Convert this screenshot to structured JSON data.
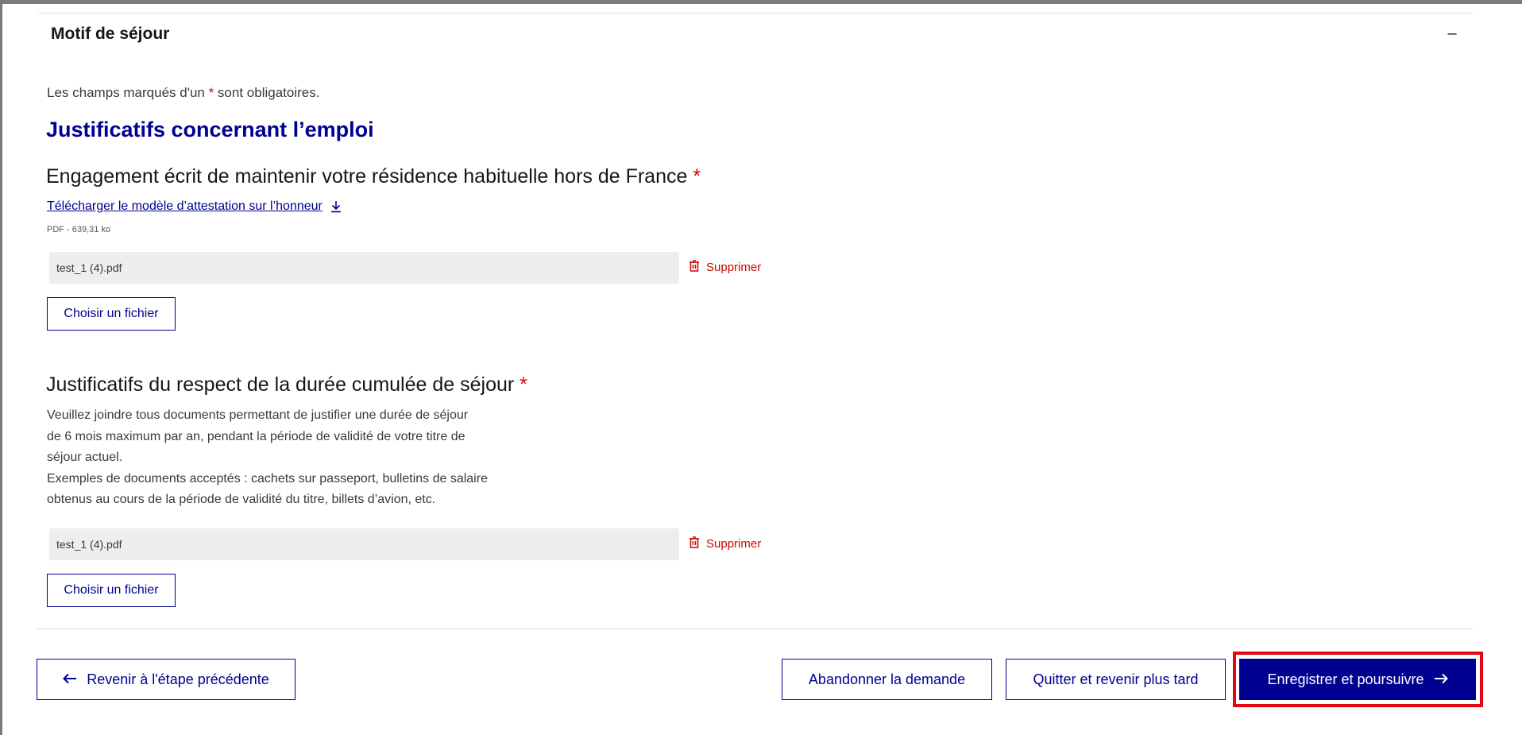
{
  "accordion": {
    "title": "Motif de séjour",
    "collapse_symbol": "–"
  },
  "form": {
    "required_note_prefix": "Les champs marqués d'un ",
    "required_note_star": "*",
    "required_note_suffix": " sont obligatoires.",
    "section_heading": "Justificatifs concernant l’emploi",
    "fields": [
      {
        "label": "Engagement écrit de maintenir votre résidence habituelle hors de France",
        "required_star": "*",
        "download_link": "Télécharger le modèle d’attestation sur l’honneur",
        "download_icon": "download-icon",
        "download_meta": "PDF - 639,31 ko",
        "file_name": "test_1 (4).pdf",
        "delete_label": "Supprimer",
        "choose_label": "Choisir un fichier"
      },
      {
        "label": "Justificatifs du respect de la durée cumulée de séjour",
        "required_star": "*",
        "description_lines": [
          "Veuillez joindre tous documents permettant de justifier une durée de séjour",
          "de 6 mois maximum par an, pendant la période de validité de votre titre de",
          "séjour actuel.",
          "Exemples de documents acceptés : cachets sur passeport, bulletins de salaire",
          "obtenus au cours de la période de validité du titre, billets d’avion, etc."
        ],
        "file_name": "test_1 (4).pdf",
        "delete_label": "Supprimer",
        "choose_label": "Choisir un fichier"
      }
    ]
  },
  "footer": {
    "back_label": "Revenir à l'étape précédente",
    "abandon_label": "Abandonner la demande",
    "quit_label": "Quitter et revenir plus tard",
    "save_label": "Enregistrer et poursuivre"
  },
  "colors": {
    "primary": "#000091",
    "danger": "#ce0500",
    "highlight": "#e30613",
    "file_bg": "#eeeeee"
  }
}
